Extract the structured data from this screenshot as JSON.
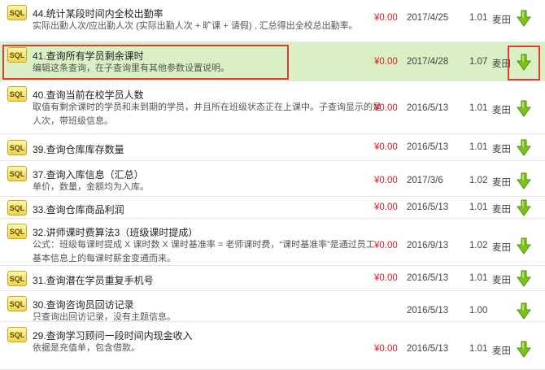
{
  "items": [
    {
      "badge": "SQL",
      "title": "44.统计某段时间内全校出勤率",
      "desc": "实际出勤人次/应出勤人次 (实际出勤人次 + 旷课 + 请假) , 汇总得出全校总出勤率。",
      "price": "¥0.00",
      "date": "2017/4/25",
      "version": "1.01",
      "author": "麦田",
      "download_icon": "download-arrow-icon",
      "highlighted": false
    },
    {
      "badge": "SQL",
      "title": "41.查询所有学员剩余课时",
      "desc": "编辑这条查询，在子查询里有其他参数设置说明。",
      "price": "¥0.00",
      "date": "2017/4/28",
      "version": "1.07",
      "author": "麦田",
      "download_icon": "download-arrow-icon",
      "highlighted": true
    },
    {
      "badge": "SQL",
      "title": "40.查询当前在校学员人数",
      "desc": "取值有剩余课时的学员和未到期的学员，并且所在班级状态正在上课中。子查询显示的是人次，带班级信息。",
      "price": "¥0.00",
      "date": "2016/5/13",
      "version": "1.01",
      "author": "麦田",
      "download_icon": "download-arrow-icon",
      "highlighted": false
    },
    {
      "badge": "SQL",
      "title": "39.查询仓库库存数量",
      "desc": "",
      "price": "¥0.00",
      "date": "2016/5/13",
      "version": "1.01",
      "author": "麦田",
      "download_icon": "download-arrow-icon",
      "highlighted": false
    },
    {
      "badge": "SQL",
      "title": "37.查询入库信息（汇总）",
      "desc": "单价，数量，金额均为入库。",
      "price": "¥0.00",
      "date": "2017/3/6",
      "version": "1.02",
      "author": "麦田",
      "download_icon": "download-arrow-icon",
      "highlighted": false
    },
    {
      "badge": "SQL",
      "title": "33.查询仓库商品利润",
      "desc": "",
      "price": "¥0.00",
      "date": "2016/5/13",
      "version": "1.01",
      "author": "麦田",
      "download_icon": "download-arrow-icon",
      "highlighted": false
    },
    {
      "badge": "SQL",
      "title": "32.讲师课时费算法3（班级课时提成）",
      "desc": "公式：班级每课时提成 X 课时数 X 课时基准率 = 老师课时费，“课时基准率”是通过员工基本信息上的每课时薪金变通而来。",
      "price": "¥0.00",
      "date": "2016/9/13",
      "version": "1.02",
      "author": "麦田",
      "download_icon": "download-arrow-icon",
      "highlighted": false
    },
    {
      "badge": "SQL",
      "title": "31.查询潜在学员重复手机号",
      "desc": "",
      "price": "¥0.00",
      "date": "2016/5/13",
      "version": "1.01",
      "author": "麦田",
      "download_icon": "download-arrow-icon",
      "highlighted": false
    },
    {
      "badge": "SQL",
      "title": "30.查询咨询员回访记录",
      "desc": "只查询出回访记录，没有主题信息。",
      "price": "",
      "date": "2016/5/13",
      "version": "1.00",
      "author": "",
      "download_icon": "download-arrow-icon",
      "highlighted": false
    },
    {
      "badge": "SQL",
      "title": "29.查询学习顾问一段时间内现金收入",
      "desc": "依据是充值单，包含借款。",
      "price": "¥0.00",
      "date": "2016/5/13",
      "version": "1.01",
      "author": "麦田",
      "download_icon": "download-arrow-icon",
      "highlighted": false
    }
  ]
}
